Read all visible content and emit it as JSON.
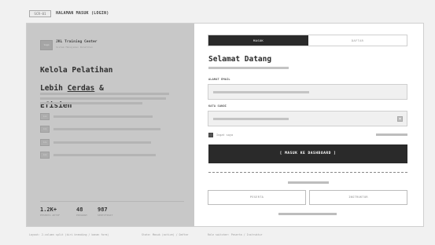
{
  "screen": {
    "id": "SCR-01",
    "title": "HALAMAN MASUK (LOGIN)"
  },
  "brand": {
    "logo_text": "logo",
    "name": "JKL Training Center",
    "tagline": "Sistem Manajemen Pelatihan"
  },
  "hero": {
    "line1": "Kelola Pelatihan",
    "line2_pre": "Lebih ",
    "line2_emph": "Cerdas",
    "line2_post": " &",
    "line3": "Efisien"
  },
  "features": [
    {
      "icon": "feature-icon",
      "label": "ico"
    },
    {
      "icon": "feature-icon",
      "label": "ico"
    },
    {
      "icon": "feature-icon",
      "label": "ico"
    },
    {
      "icon": "feature-icon",
      "label": "ico"
    }
  ],
  "stats": [
    {
      "value": "1.2K+",
      "label": "PESERTA AKTIF"
    },
    {
      "value": "48",
      "label": "PROGRAM"
    },
    {
      "value": "987",
      "label": "SERTIFIKAT"
    }
  ],
  "tabs": {
    "login": "MASUK",
    "register": "DAFTAR",
    "active": "login"
  },
  "form": {
    "heading": "Selamat Datang",
    "email_label": "ALAMAT EMAIL",
    "password_label": "KATA SANDI",
    "password_toggle_icon": "eye-icon",
    "remember_label": "Ingat saya",
    "remember_checked": true,
    "submit_label": "[ MASUK KE DASHBOARD ]"
  },
  "roles": {
    "participant": "PESERTA",
    "instructor": "INSTRUKTUR"
  },
  "footer": {
    "layout_note": "Layout: 2-column split (kiri branding / kanan form)",
    "state_note": "State: Masuk (active) / Daftar",
    "role_note": "Role switcher: Peserta / Instruktur"
  },
  "colors": {
    "background": "#f1f1f1",
    "left_panel": "#c8c8c8",
    "primary_dark": "#2a2a2a",
    "input_fill": "#f0f0f0"
  }
}
